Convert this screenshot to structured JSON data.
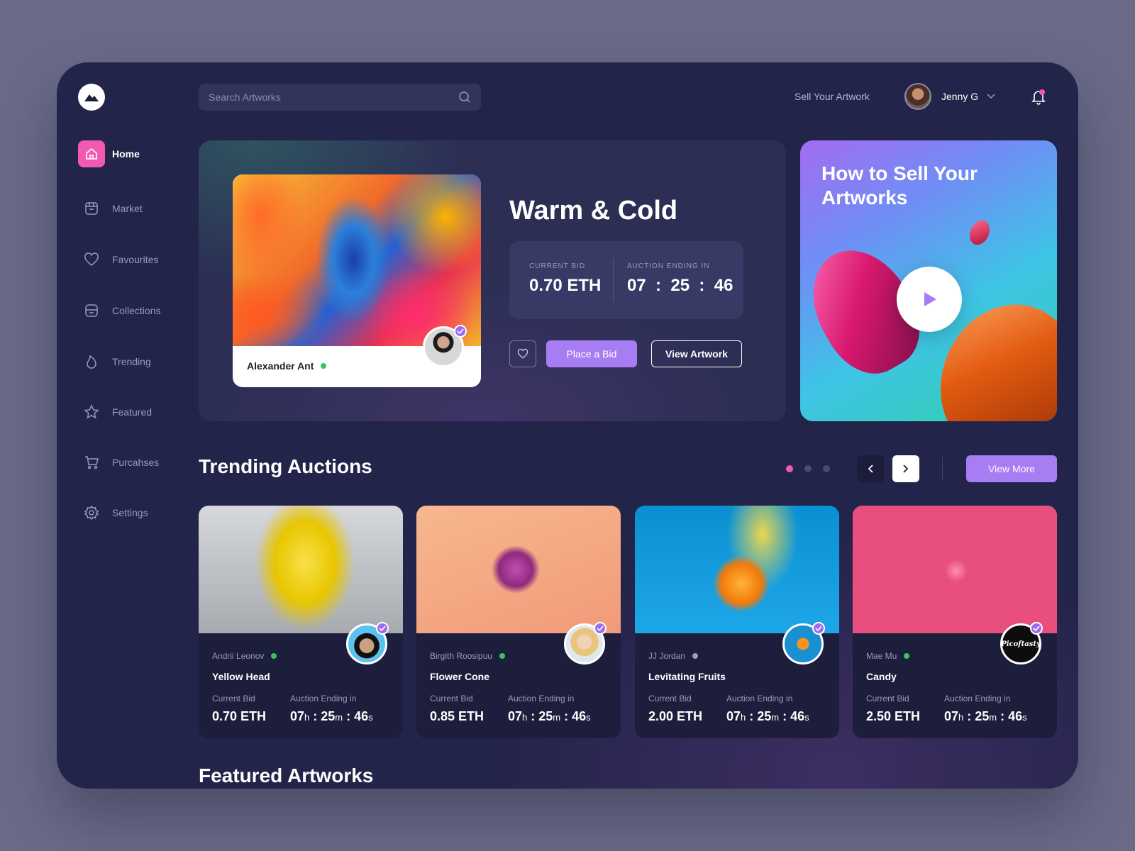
{
  "search": {
    "placeholder": "Search Artworks"
  },
  "header": {
    "sell_link": "Sell Your Artwork",
    "user_name": "Jenny G"
  },
  "sidebar": {
    "items": [
      {
        "label": "Home",
        "icon": "home-icon",
        "active": true
      },
      {
        "label": "Market",
        "icon": "market-icon"
      },
      {
        "label": "Favourites",
        "icon": "heart-icon"
      },
      {
        "label": "Collections",
        "icon": "folder-icon"
      },
      {
        "label": "Trending",
        "icon": "flame-icon"
      },
      {
        "label": "Featured",
        "icon": "star-icon"
      },
      {
        "label": "Purcahses",
        "icon": "cart-icon"
      },
      {
        "label": "Settings",
        "icon": "gear-icon"
      }
    ]
  },
  "hero": {
    "title": "Warm & Cold",
    "artist": "Alexander Ant",
    "current_bid_label": "CURRENT BID",
    "current_bid": "0.70 ETH",
    "auction_label": "AUCTION ENDING IN",
    "auction_time": "07  :  25  :  46",
    "place_bid": "Place a Bid",
    "view_artwork": "View Artwork"
  },
  "promo": {
    "title": "How to Sell Your Artworks"
  },
  "trending": {
    "title": "Trending Auctions",
    "view_more": "View More",
    "bid_label": "Current Bid",
    "ending_label": "Auction Ending in",
    "cards": [
      {
        "artist": "Andrii Leonov",
        "title": "Yellow Head",
        "bid": "0.70 ETH",
        "h": "07",
        "m": "25",
        "s": "46",
        "online": true
      },
      {
        "artist": "Birgith Roosipuu",
        "title": "Flower Cone",
        "bid": "0.85 ETH",
        "h": "07",
        "m": "25",
        "s": "46",
        "online": true
      },
      {
        "artist": "JJ Jordan",
        "title": "Levitating Fruits",
        "bid": "2.00 ETH",
        "h": "07",
        "m": "25",
        "s": "46",
        "online": false
      },
      {
        "artist": "Mae Mu",
        "title": "Candy",
        "bid": "2.50 ETH",
        "h": "07",
        "m": "25",
        "s": "46",
        "online": true,
        "avatar_text": "Picoftasty"
      }
    ]
  },
  "featured": {
    "title": "Featured Artworks"
  },
  "colors": {
    "accent": "#a77df3",
    "active_nav": "#f25ab2",
    "online": "#3bc45a"
  }
}
